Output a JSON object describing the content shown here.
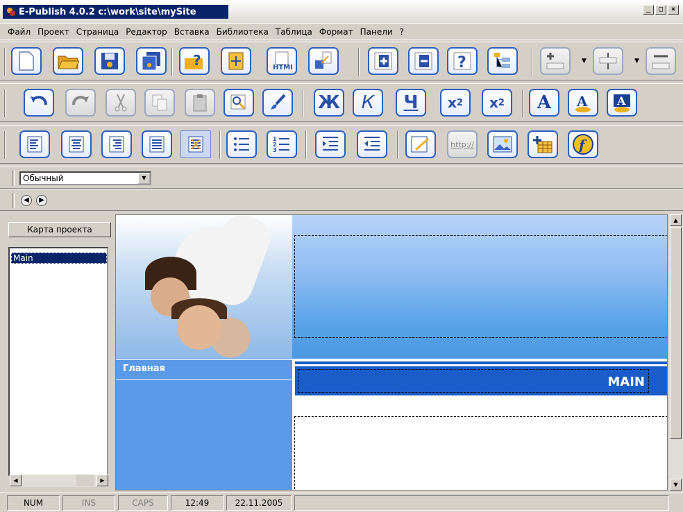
{
  "window": {
    "title": "E-Publish 4.0.2   c:\\work\\site\\mySite",
    "min_label": "_",
    "max_label": "□",
    "close_label": "×"
  },
  "menu": [
    "Файл",
    "Проект",
    "Страница",
    "Редактор",
    "Вставка",
    "Библиотека",
    "Таблица",
    "Формат",
    "Панели",
    "?"
  ],
  "toolbar_row2": {
    "bold": "Ж",
    "italic": "К",
    "underline": "Ч",
    "subscript_base": "x",
    "subscript_digit": "2",
    "superscript_base": "x",
    "superscript_digit": "2",
    "font_a": "A"
  },
  "toolbar_row3": {
    "http_label": "http://"
  },
  "style_select": {
    "value": "Обычный"
  },
  "left_panel": {
    "tab_label": "Карта проекта",
    "tree_items": [
      "Main"
    ]
  },
  "canvas": {
    "nav_heading": "Главная",
    "main_label": "MAIN"
  },
  "status": {
    "num": "NUM",
    "ins": "INS",
    "caps": "CAPS",
    "time": "12:49",
    "date": "22.11.2005"
  },
  "colors": {
    "title_bar": "#0a246a",
    "accent_blue": "#1a5cc8",
    "nav_blue": "#5a9ae8",
    "toolbar_border": "#2b5fbf"
  }
}
